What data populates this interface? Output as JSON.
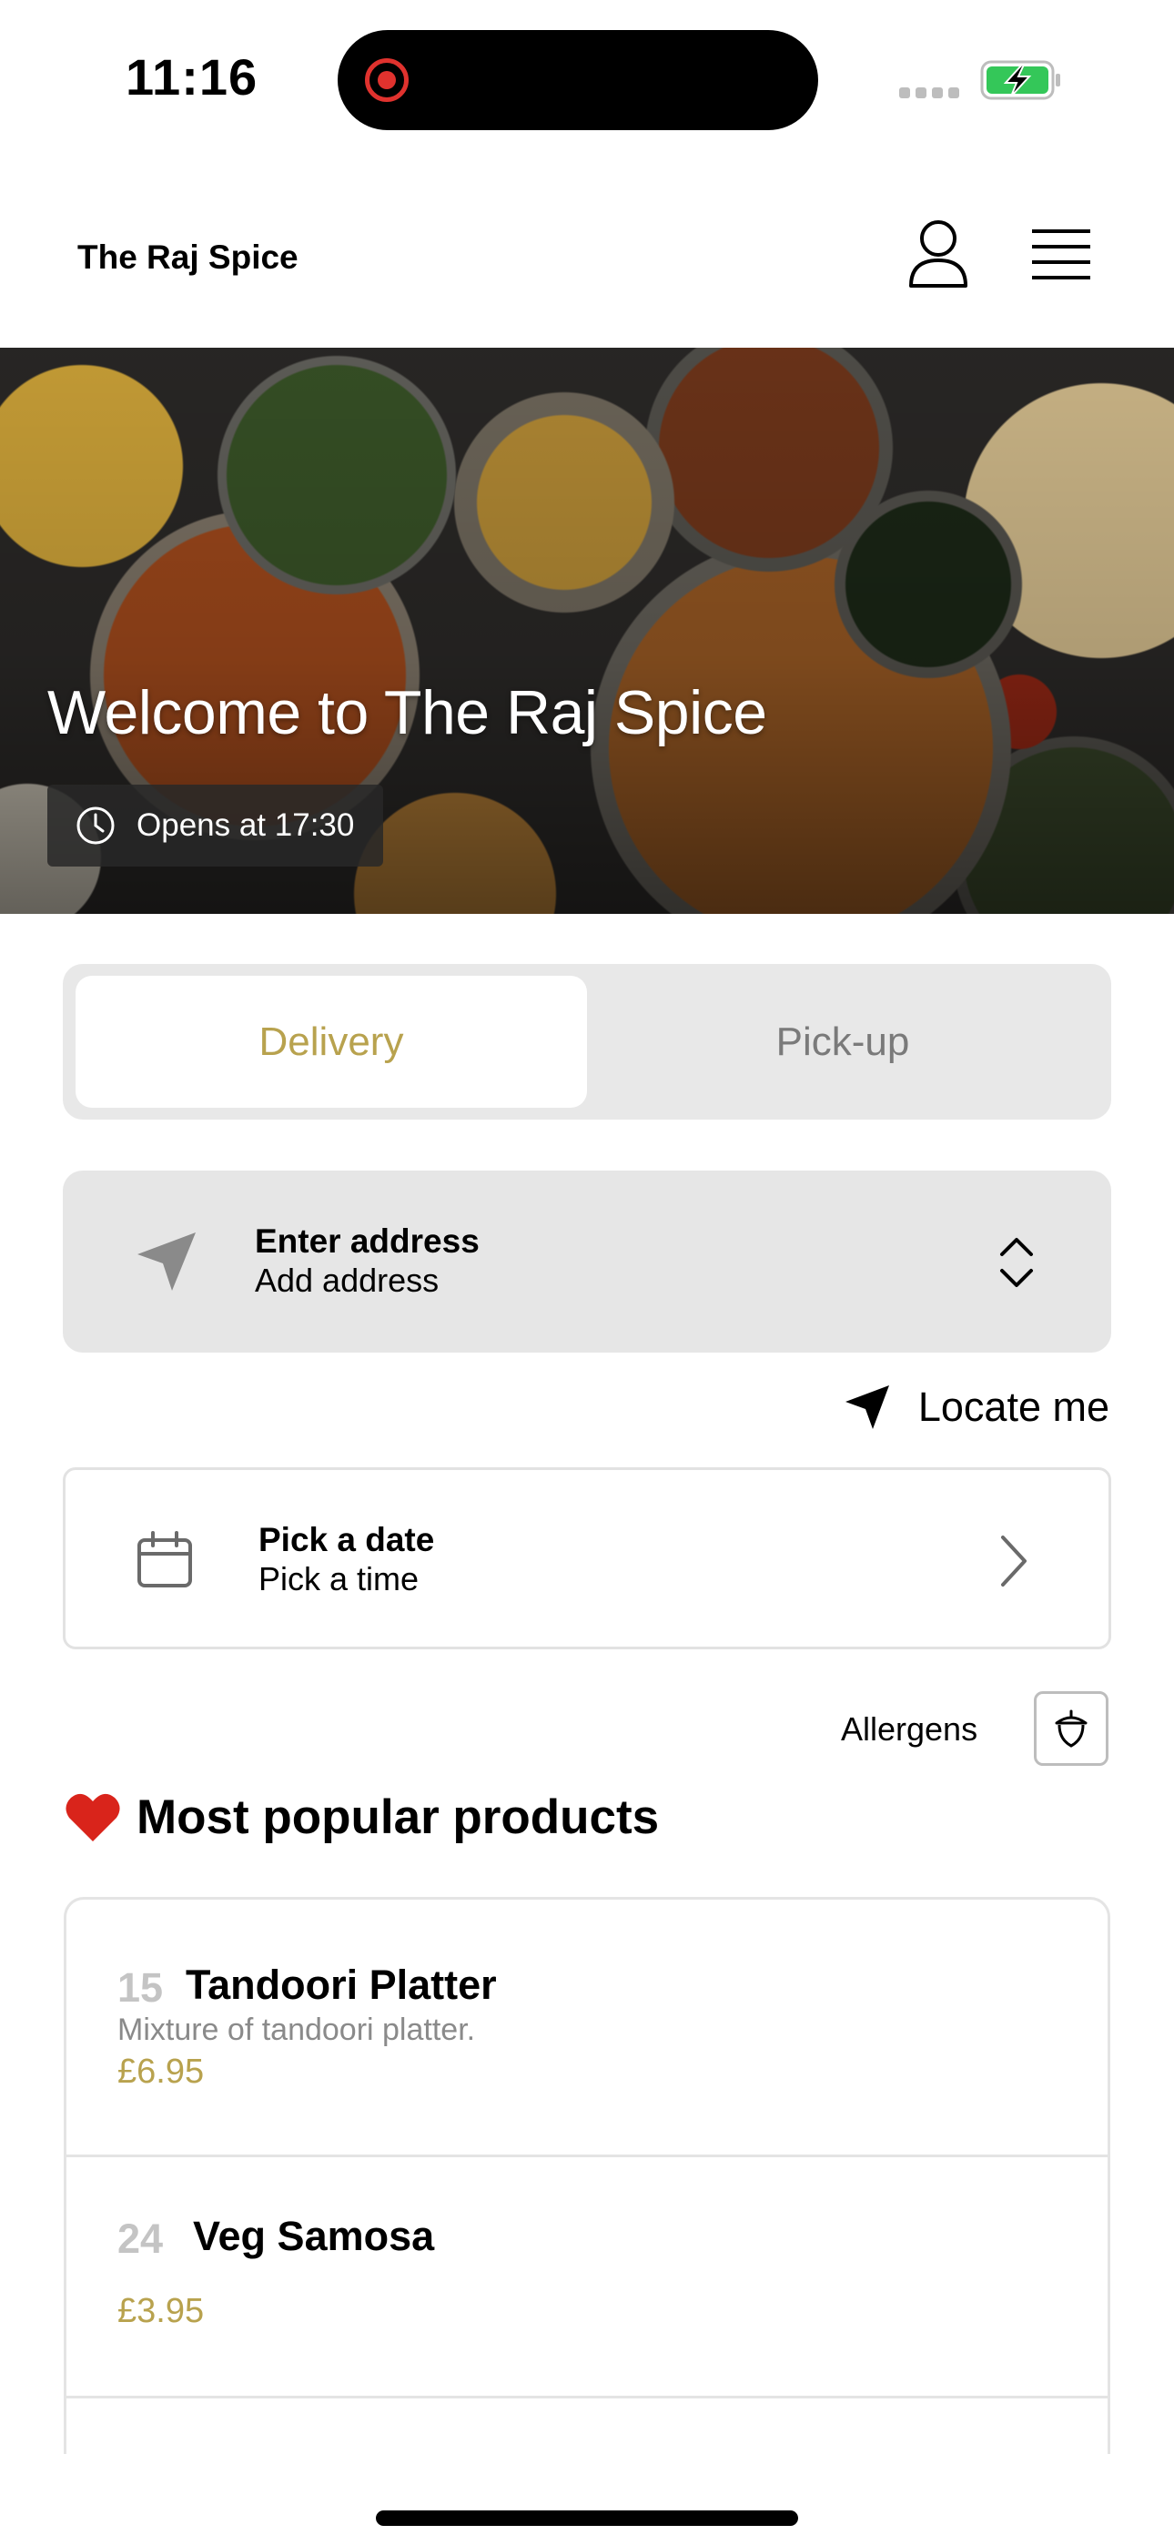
{
  "status_bar": {
    "time": "11:16"
  },
  "header": {
    "brand": "The Raj Spice"
  },
  "hero": {
    "title": "Welcome to The Raj Spice",
    "opens_text": "Opens at 17:30"
  },
  "order_mode": {
    "options": [
      "Delivery",
      "Pick-up"
    ],
    "selected": "Delivery"
  },
  "address": {
    "title": "Enter address",
    "subtitle": "Add address"
  },
  "locate": {
    "label": "Locate me"
  },
  "schedule": {
    "title": "Pick a date",
    "subtitle": "Pick a time"
  },
  "allergens": {
    "label": "Allergens"
  },
  "popular": {
    "heading": "Most popular products",
    "products": [
      {
        "number": "15",
        "name": "Tandoori Platter",
        "description": "Mixture of tandoori platter.",
        "price": "£6.95"
      },
      {
        "number": "24",
        "name": "Veg Samosa",
        "description": "",
        "price": "£3.95"
      }
    ]
  },
  "colors": {
    "accent": "#b8a24e",
    "segment_bg": "#e8e8e8",
    "card_bg": "#e6e6e6",
    "record": "#e0322e",
    "battery": "#34c759"
  }
}
